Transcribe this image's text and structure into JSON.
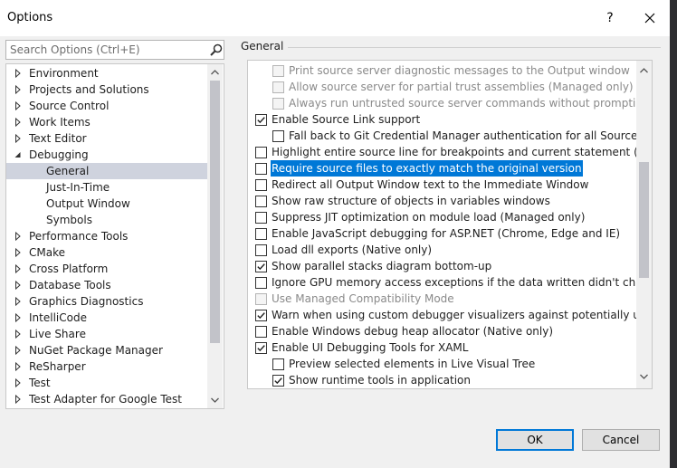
{
  "window": {
    "title": "Options",
    "help_label": "?"
  },
  "search": {
    "placeholder": "Search Options (Ctrl+E)"
  },
  "tree": [
    {
      "label": "Environment",
      "level": 0,
      "state": "collapsed"
    },
    {
      "label": "Projects and Solutions",
      "level": 0,
      "state": "collapsed"
    },
    {
      "label": "Source Control",
      "level": 0,
      "state": "collapsed"
    },
    {
      "label": "Work Items",
      "level": 0,
      "state": "collapsed"
    },
    {
      "label": "Text Editor",
      "level": 0,
      "state": "collapsed"
    },
    {
      "label": "Debugging",
      "level": 0,
      "state": "expanded"
    },
    {
      "label": "General",
      "level": 1,
      "state": "leaf",
      "selected": true
    },
    {
      "label": "Just-In-Time",
      "level": 1,
      "state": "leaf"
    },
    {
      "label": "Output Window",
      "level": 1,
      "state": "leaf"
    },
    {
      "label": "Symbols",
      "level": 1,
      "state": "leaf"
    },
    {
      "label": "Performance Tools",
      "level": 0,
      "state": "collapsed"
    },
    {
      "label": "CMake",
      "level": 0,
      "state": "collapsed"
    },
    {
      "label": "Cross Platform",
      "level": 0,
      "state": "collapsed"
    },
    {
      "label": "Database Tools",
      "level": 0,
      "state": "collapsed"
    },
    {
      "label": "Graphics Diagnostics",
      "level": 0,
      "state": "collapsed"
    },
    {
      "label": "IntelliCode",
      "level": 0,
      "state": "collapsed"
    },
    {
      "label": "Live Share",
      "level": 0,
      "state": "collapsed"
    },
    {
      "label": "NuGet Package Manager",
      "level": 0,
      "state": "collapsed"
    },
    {
      "label": "ReSharper",
      "level": 0,
      "state": "collapsed"
    },
    {
      "label": "Test",
      "level": 0,
      "state": "collapsed"
    },
    {
      "label": "Test Adapter for Google Test",
      "level": 0,
      "state": "collapsed"
    }
  ],
  "section": {
    "label": "General"
  },
  "options": [
    {
      "label": "Print source server diagnostic messages to the Output window",
      "indent": 1,
      "checked": false,
      "disabled": true
    },
    {
      "label": "Allow source server for partial trust assemblies (Managed only)",
      "indent": 1,
      "checked": false,
      "disabled": true
    },
    {
      "label": "Always run untrusted source server commands without prompting",
      "indent": 1,
      "checked": false,
      "disabled": true
    },
    {
      "label": "Enable Source Link support",
      "indent": 0,
      "checked": true,
      "disabled": false
    },
    {
      "label": "Fall back to Git Credential Manager authentication for all Source Link re",
      "indent": 1,
      "checked": false,
      "disabled": false
    },
    {
      "label": "Highlight entire source line for breakpoints and current statement (C++ on",
      "indent": 0,
      "checked": false,
      "disabled": false
    },
    {
      "label": "Require source files to exactly match the original version",
      "indent": 0,
      "checked": false,
      "disabled": false,
      "selected": true
    },
    {
      "label": "Redirect all Output Window text to the Immediate Window",
      "indent": 0,
      "checked": false,
      "disabled": false
    },
    {
      "label": "Show raw structure of objects in variables windows",
      "indent": 0,
      "checked": false,
      "disabled": false
    },
    {
      "label": "Suppress JIT optimization on module load (Managed only)",
      "indent": 0,
      "checked": false,
      "disabled": false
    },
    {
      "label": "Enable JavaScript debugging for ASP.NET (Chrome, Edge and IE)",
      "indent": 0,
      "checked": false,
      "disabled": false
    },
    {
      "label": "Load dll exports (Native only)",
      "indent": 0,
      "checked": false,
      "disabled": false
    },
    {
      "label": "Show parallel stacks diagram bottom-up",
      "indent": 0,
      "checked": true,
      "disabled": false
    },
    {
      "label": "Ignore GPU memory access exceptions if the data written didn't change the",
      "indent": 0,
      "checked": false,
      "disabled": false
    },
    {
      "label": "Use Managed Compatibility Mode",
      "indent": 0,
      "checked": false,
      "disabled": true
    },
    {
      "label": "Warn when using custom debugger visualizers against potentially unsafe p",
      "indent": 0,
      "checked": true,
      "disabled": false
    },
    {
      "label": "Enable Windows debug heap allocator (Native only)",
      "indent": 0,
      "checked": false,
      "disabled": false
    },
    {
      "label": "Enable UI Debugging Tools for XAML",
      "indent": 0,
      "checked": true,
      "disabled": false
    },
    {
      "label": "Preview selected elements in Live Visual Tree",
      "indent": 1,
      "checked": false,
      "disabled": false
    },
    {
      "label": "Show runtime tools in application",
      "indent": 1,
      "checked": true,
      "disabled": false
    }
  ],
  "buttons": {
    "ok": "OK",
    "cancel": "Cancel"
  }
}
